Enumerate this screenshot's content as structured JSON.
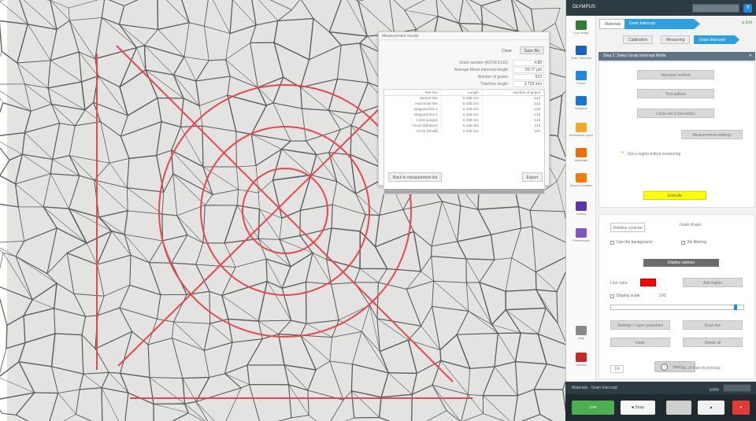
{
  "window": {
    "title": "OLYMPUS",
    "help_label": "?"
  },
  "image": {
    "colors": {
      "background": "#e3e4e1",
      "grain_boundary": "#5a5e5c",
      "overlay": "#e8474f"
    }
  },
  "dialog": {
    "title": "Measurement results",
    "actions": [
      "Close",
      "Save file"
    ],
    "stats": [
      {
        "label": "Grain number (ASTM E112)",
        "value": "4.88"
      },
      {
        "label": "Average Mean intercept length",
        "value": "59.77 µm"
      },
      {
        "label": "Number of grains",
        "value": "622"
      },
      {
        "label": "Total line length",
        "value": "3.729 mm"
      }
    ],
    "table": {
      "headers": [
        "Test line",
        "Length",
        "Number of grains"
      ],
      "rows": [
        [
          "Vertical line",
          "0.438 mm",
          "143"
        ],
        [
          "Horizontal line",
          "0.438 mm",
          "143"
        ],
        [
          "Diagonal line 1",
          "0.438 mm",
          "143"
        ],
        [
          "Diagonal line 2",
          "0.438 mm",
          "143"
        ],
        [
          "Circle (Large)",
          "0.438 mm",
          "143"
        ],
        [
          "Circle (Medium)",
          "0.438 mm",
          "143"
        ],
        [
          "Circle (Small)",
          "0.438 mm",
          "143"
        ]
      ]
    },
    "footer": {
      "left": "Back to measurement list",
      "right": "Export"
    }
  },
  "tools": [
    {
      "name": "Live Image",
      "icon": "live-image-icon",
      "color": "#2e7d32"
    },
    {
      "name": "Grain Intercept",
      "icon": "grain-intercept-icon",
      "color": "#1565c0"
    },
    {
      "name": "Phase",
      "icon": "phase-icon",
      "color": "#1e88e5"
    },
    {
      "name": "Measure",
      "icon": "measure-icon",
      "color": "#1976d2"
    },
    {
      "name": "Annotation Layer",
      "icon": "annotation-icon",
      "color": "#f9a825"
    },
    {
      "name": "Materials",
      "icon": "materials-icon",
      "color": "#ef6c00"
    },
    {
      "name": "Report Creation",
      "icon": "report-icon",
      "color": "#f57c00"
    },
    {
      "name": "Gallery",
      "icon": "gallery-icon",
      "color": "#5e35b1"
    },
    {
      "name": "Preferences",
      "icon": "preferences-icon",
      "color": "#7e57c2"
    },
    {
      "name": "Help",
      "icon": "help-icon",
      "color": "#888888"
    },
    {
      "name": "Camera",
      "icon": "camera-icon",
      "color": "#c62828"
    }
  ],
  "panel": {
    "breadcrumb": [
      "Materials",
      "Grain Intercept"
    ],
    "exit_label": "Exit",
    "tabs": [
      "Calibration",
      "Measuring",
      "Grain Intercept"
    ],
    "section_title": "Step 2: Select Grain Intercept Mode",
    "buttons": {
      "intercept": "Intercept method",
      "pattern": "Test pattern",
      "circle": "Circle set (Concentric)",
      "measure_settings": "Measurement settings",
      "execute": "Execute",
      "grain_shape": "Grain shape",
      "display_options": "Display options",
      "add_region": "Add region",
      "settings_layer": "Settings / Layer properties",
      "draw_line": "Draw line",
      "undo": "Undo",
      "delete_all": "Delete all",
      "start": "Start"
    },
    "warning_text": "Set a region before measuring",
    "select_label": "Relative contrast",
    "checkbox_use_background": "Use the background",
    "checkbox_no_filtering": "No filtering",
    "color_label": "Line color",
    "color_value": "#ff0000",
    "chk_display_scale": "Display scale",
    "scale_value": "100",
    "pair_left": "1/4",
    "pair_right": "No. of lines to process"
  },
  "statusbar": {
    "text": "Materials - Grain Intercept",
    "zoom": "100%"
  },
  "bottombar": {
    "record": "Live",
    "snapshot": "Snap",
    "gray1": "",
    "gray2": "",
    "stop": ""
  }
}
